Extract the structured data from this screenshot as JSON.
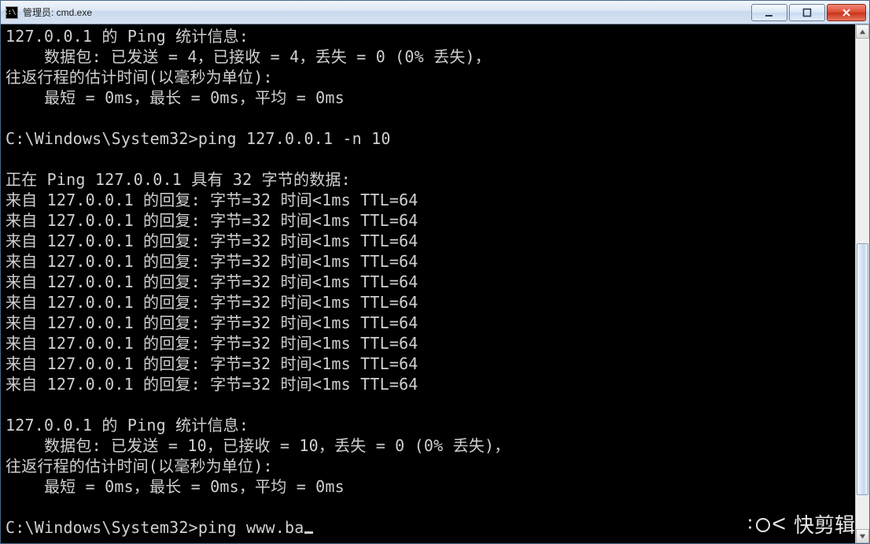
{
  "window": {
    "title": "管理员: cmd.exe",
    "sysicon_text": "C:\\."
  },
  "terminal": {
    "lines": [
      "127.0.0.1 的 Ping 统计信息:",
      "    数据包: 已发送 = 4，已接收 = 4，丢失 = 0 (0% 丢失)，",
      "往返行程的估计时间(以毫秒为单位):",
      "    最短 = 0ms，最长 = 0ms，平均 = 0ms",
      "",
      "C:\\Windows\\System32>ping 127.0.0.1 -n 10",
      "",
      "正在 Ping 127.0.0.1 具有 32 字节的数据:",
      "来自 127.0.0.1 的回复: 字节=32 时间<1ms TTL=64",
      "来自 127.0.0.1 的回复: 字节=32 时间<1ms TTL=64",
      "来自 127.0.0.1 的回复: 字节=32 时间<1ms TTL=64",
      "来自 127.0.0.1 的回复: 字节=32 时间<1ms TTL=64",
      "来自 127.0.0.1 的回复: 字节=32 时间<1ms TTL=64",
      "来自 127.0.0.1 的回复: 字节=32 时间<1ms TTL=64",
      "来自 127.0.0.1 的回复: 字节=32 时间<1ms TTL=64",
      "来自 127.0.0.1 的回复: 字节=32 时间<1ms TTL=64",
      "来自 127.0.0.1 的回复: 字节=32 时间<1ms TTL=64",
      "来自 127.0.0.1 的回复: 字节=32 时间<1ms TTL=64",
      "",
      "127.0.0.1 的 Ping 统计信息:",
      "    数据包: 已发送 = 10，已接收 = 10，丢失 = 0 (0% 丢失)，",
      "往返行程的估计时间(以毫秒为单位):",
      "    最短 = 0ms，最长 = 0ms，平均 = 0ms",
      "",
      "C:\\Windows\\System32>ping www.ba"
    ],
    "current_input": "ping www.ba",
    "prompt": "C:\\Windows\\System32>"
  },
  "watermark": {
    "text": "快剪辑"
  }
}
